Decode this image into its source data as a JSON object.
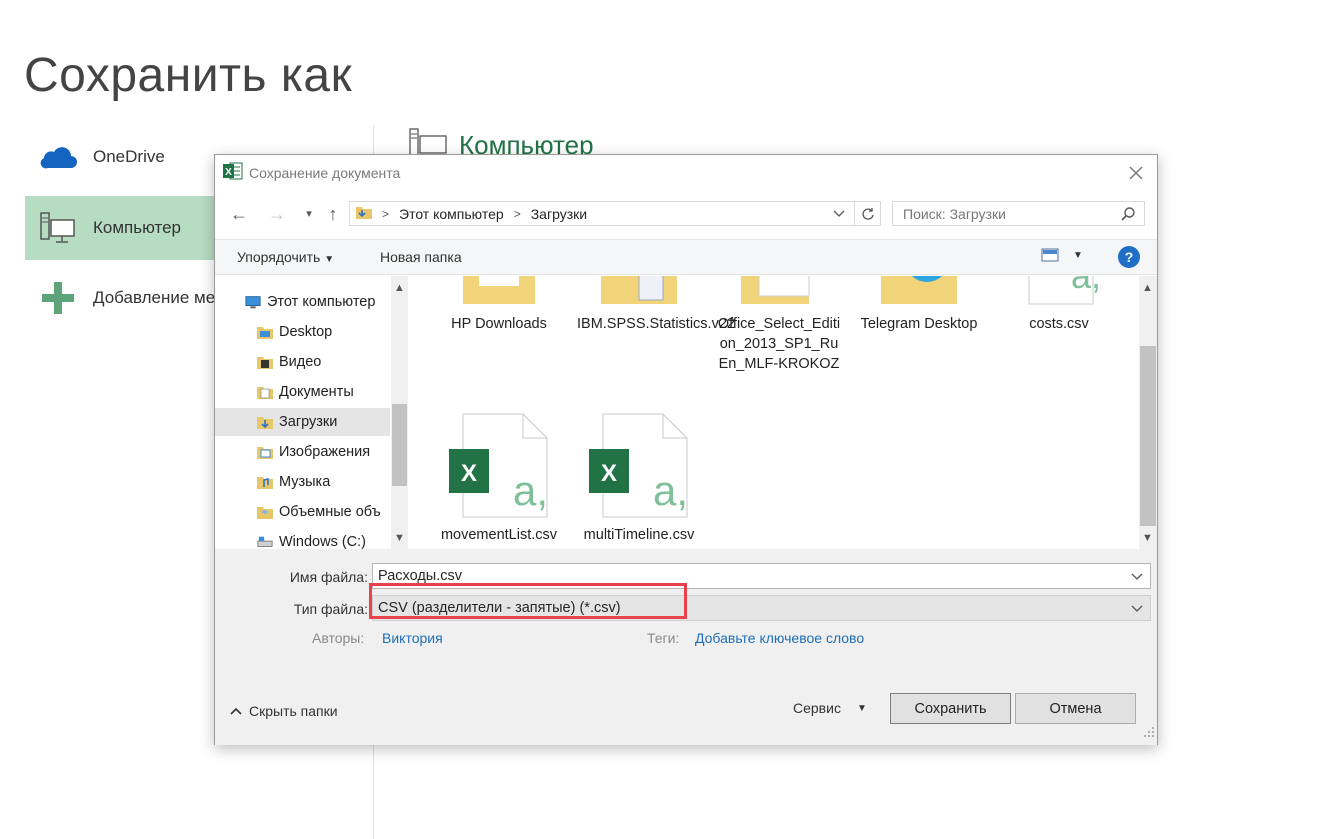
{
  "backstage": {
    "title": "Сохранить как",
    "nav": [
      {
        "label": "OneDrive",
        "icon": "cloud-icon"
      },
      {
        "label": "Компьютер",
        "icon": "computer-icon",
        "selected": true
      },
      {
        "label": "Добавление ме",
        "icon": "plus-icon"
      }
    ],
    "main_heading": "Компьютер"
  },
  "dialog": {
    "title": "Сохранение документа",
    "address": {
      "crumbs": [
        "Этот компьютер",
        "Загрузки"
      ]
    },
    "search_placeholder": "Поиск: Загрузки",
    "toolbar": {
      "organize": "Упорядочить",
      "new_folder": "Новая папка",
      "help": "?"
    },
    "tree": [
      {
        "label": "Этот компьютер",
        "icon": "computer-icon"
      },
      {
        "label": "Desktop",
        "icon": "folder-icon"
      },
      {
        "label": "Видео",
        "icon": "video-folder-icon"
      },
      {
        "label": "Документы",
        "icon": "documents-folder-icon"
      },
      {
        "label": "Загрузки",
        "icon": "downloads-folder-icon",
        "selected": true
      },
      {
        "label": "Изображения",
        "icon": "pictures-folder-icon"
      },
      {
        "label": "Музыка",
        "icon": "music-folder-icon"
      },
      {
        "label": "Объемные объ",
        "icon": "3d-objects-folder-icon"
      },
      {
        "label": "Windows (C:)",
        "icon": "drive-icon"
      }
    ],
    "files": [
      {
        "label": "HP Downloads",
        "type": "folder"
      },
      {
        "label": "IBM.SPSS.Statistics.v22",
        "type": "folder"
      },
      {
        "label": "Office_Select_Edition_2013_SP1_RuEn_MLF-KROKOZ",
        "type": "folder"
      },
      {
        "label": "Telegram Desktop",
        "type": "folder"
      },
      {
        "label": "costs.csv",
        "type": "csv"
      },
      {
        "label": "movementList.csv",
        "type": "csv"
      },
      {
        "label": "multiTimeline.csv",
        "type": "csv"
      }
    ],
    "filename_label": "Имя файла:",
    "filename_value": "Расходы.csv",
    "filetype_label": "Тип файла:",
    "filetype_value": "CSV (разделители - запятые) (*.csv)",
    "authors_label": "Авторы:",
    "authors_value": "Виктория",
    "tags_label": "Теги:",
    "tags_value": "Добавьте ключевое слово",
    "hide_folders": "Скрыть папки",
    "service": "Сервис",
    "save": "Сохранить",
    "cancel": "Отмена"
  },
  "colors": {
    "accent": "#217346",
    "selected_nav": "#b6dcc2",
    "highlight": "#e8424a",
    "link": "#1e6fb8"
  }
}
